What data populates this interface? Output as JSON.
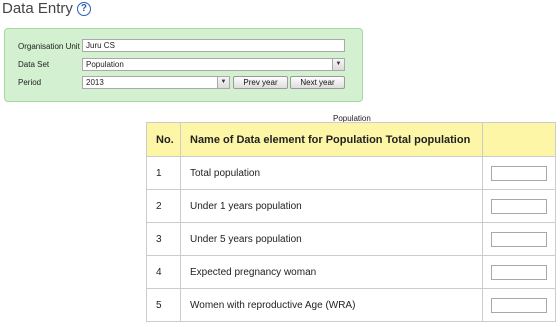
{
  "header": {
    "title": "Data Entry",
    "help_icon": "help-circle-icon"
  },
  "selection": {
    "org_unit": {
      "label": "Organisation Unit",
      "value": "Juru CS"
    },
    "data_set": {
      "label": "Data Set",
      "value": "Population"
    },
    "period": {
      "label": "Period",
      "value": "2013",
      "prev_label": "Prev year",
      "next_label": "Next year"
    },
    "panel_color": "#d3f0d0"
  },
  "section": {
    "caption": "Population"
  },
  "table": {
    "header_color": "#fdf6a7",
    "columns": [
      "No.",
      "Name of Data element for Population Total population",
      ""
    ],
    "rows": [
      {
        "no": "1",
        "name": "Total population",
        "value": ""
      },
      {
        "no": "2",
        "name": "Under 1 years population",
        "value": ""
      },
      {
        "no": "3",
        "name": "Under 5 years population",
        "value": ""
      },
      {
        "no": "4",
        "name": "Expected pregnancy woman",
        "value": ""
      },
      {
        "no": "5",
        "name": "Women with reproductive Age (WRA)",
        "value": ""
      }
    ]
  }
}
